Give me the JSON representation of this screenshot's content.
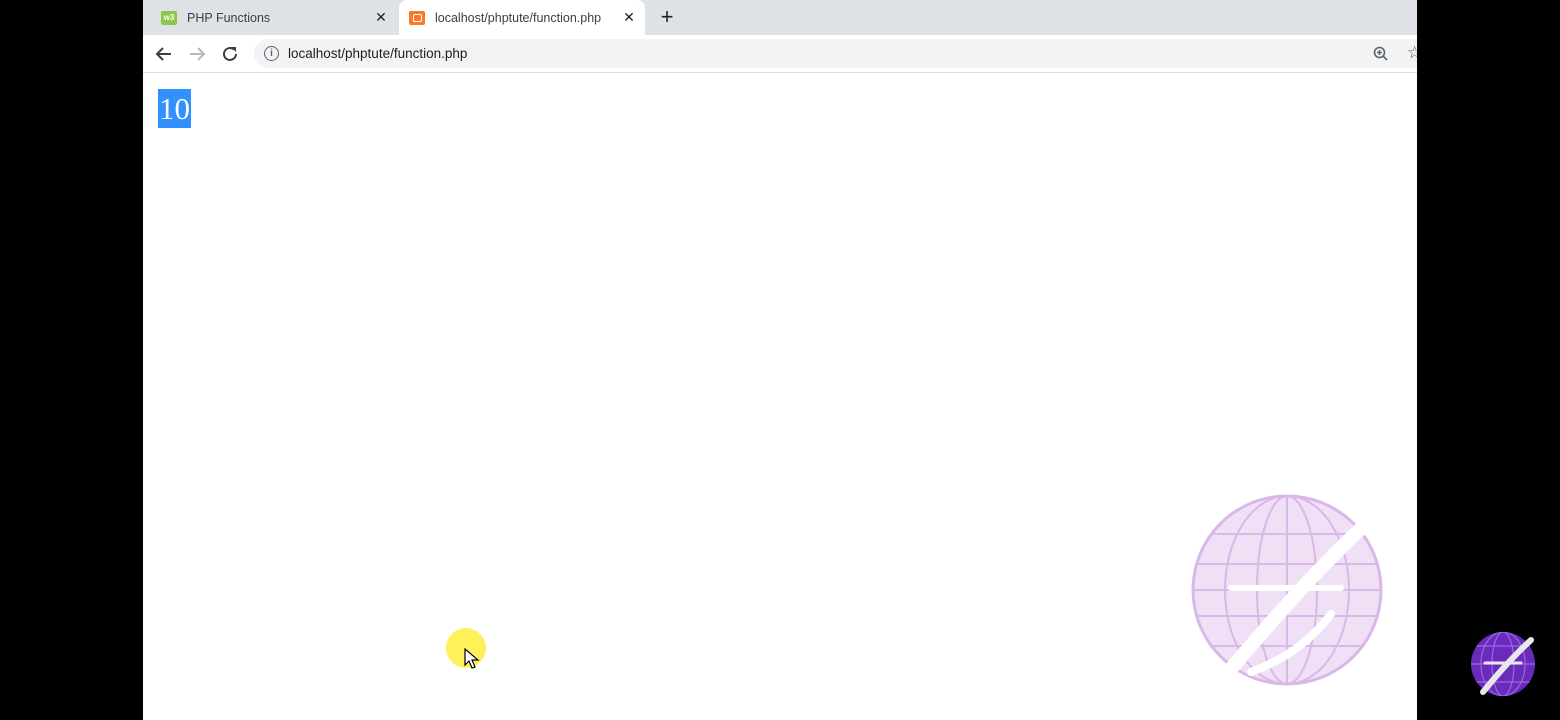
{
  "browser": {
    "tabs": [
      {
        "label": "PHP Functions",
        "favicon": "w3schools-icon",
        "active": false
      },
      {
        "label": "localhost/phptute/function.php",
        "favicon": "xampp-icon",
        "active": true
      }
    ],
    "new_tab_symbol": "+",
    "close_symbol": "✕",
    "address": "localhost/phptute/function.php"
  },
  "page": {
    "output_text": "10",
    "selection_color": "#3390ff"
  },
  "colors": {
    "tabstrip": "#dee1e6",
    "omnibox": "#f1f3f4",
    "watermark": "#d9b7e8",
    "corner_logo": "#6a2bbd"
  }
}
